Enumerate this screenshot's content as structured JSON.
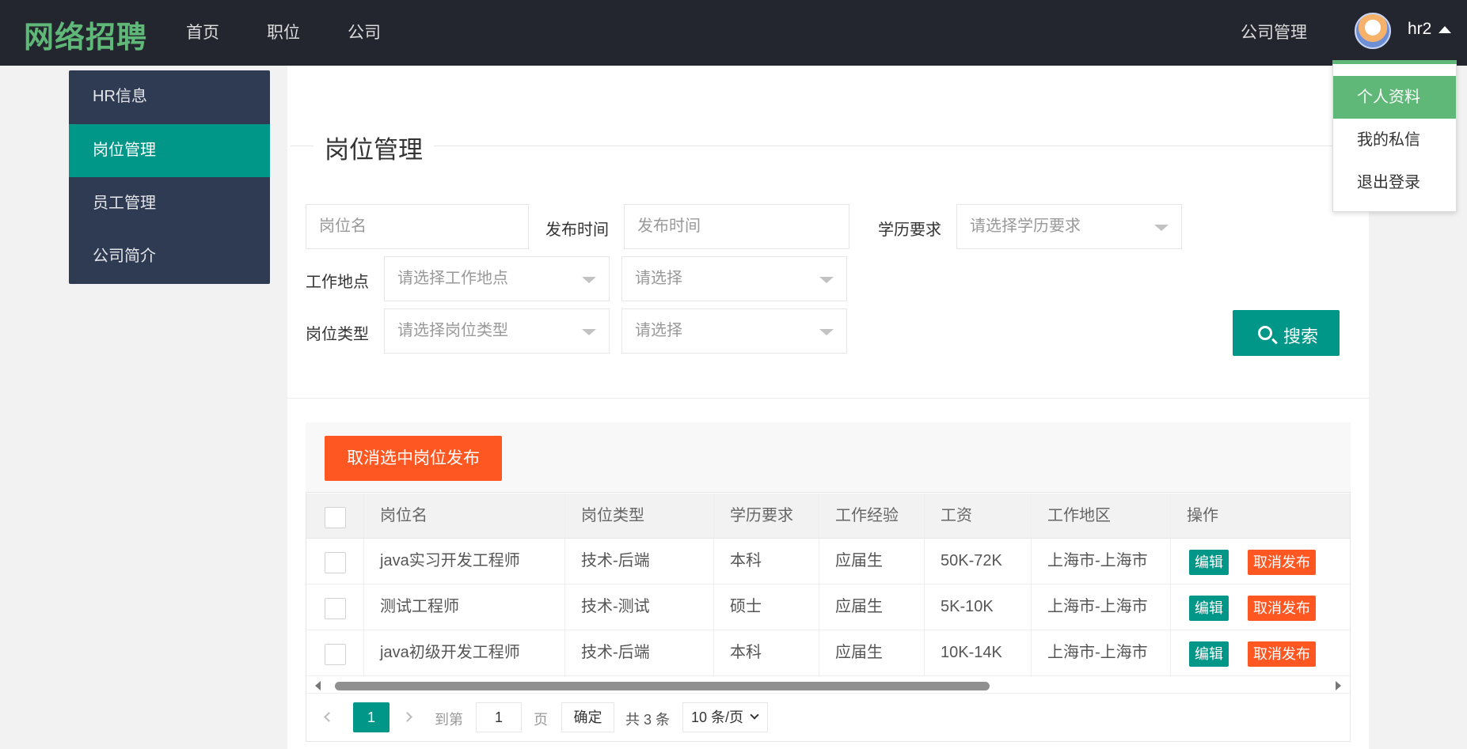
{
  "app": {
    "logo": "网络招聘"
  },
  "nav": {
    "items": [
      "首页",
      "职位",
      "公司"
    ],
    "company_manage": "公司管理",
    "username": "hr2"
  },
  "user_menu": {
    "items": [
      "个人资料",
      "我的私信",
      "退出登录"
    ],
    "active_index": 0
  },
  "sidebar": {
    "items": [
      "HR信息",
      "岗位管理",
      "员工管理",
      "公司简介"
    ],
    "active_index": 1
  },
  "page": {
    "title": "岗位管理"
  },
  "filters": {
    "job_name_placeholder": "岗位名",
    "publish_time_label": "发布时间",
    "publish_time_placeholder": "发布时间",
    "education_label": "学历要求",
    "education_placeholder": "请选择学历要求",
    "location_label": "工作地点",
    "location_placeholder": "请选择工作地点",
    "location_sub_placeholder": "请选择",
    "type_label": "岗位类型",
    "type_placeholder": "请选择岗位类型",
    "type_sub_placeholder": "请选择",
    "search_button": "搜索"
  },
  "table": {
    "batch_button": "取消选中岗位发布",
    "columns": [
      "岗位名",
      "岗位类型",
      "学历要求",
      "工作经验",
      "工资",
      "工作地区",
      "操作"
    ],
    "rows": [
      {
        "name": "java实习开发工程师",
        "type": "技术-后端",
        "education": "本科",
        "experience": "应届生",
        "salary": "50K-72K",
        "area": "上海市-上海市"
      },
      {
        "name": "测试工程师",
        "type": "技术-测试",
        "education": "硕士",
        "experience": "应届生",
        "salary": "5K-10K",
        "area": "上海市-上海市"
      },
      {
        "name": "java初级开发工程师",
        "type": "技术-后端",
        "education": "本科",
        "experience": "应届生",
        "salary": "10K-14K",
        "area": "上海市-上海市"
      }
    ],
    "actions": {
      "edit": "编辑",
      "unpublish": "取消发布"
    }
  },
  "pagination": {
    "current_page": "1",
    "goto_label": "到第",
    "goto_value": "1",
    "page_unit": "页",
    "confirm": "确定",
    "total": "共 3 条",
    "page_size": "10 条/页"
  },
  "colors": {
    "topbar": "#23262e",
    "logo": "#5fb878",
    "primary": "#009688",
    "danger": "#ff5722",
    "sidebar": "#2f3b52"
  }
}
